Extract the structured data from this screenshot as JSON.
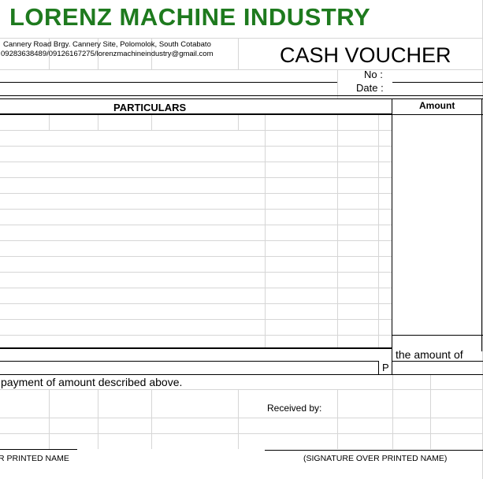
{
  "header": {
    "company_name": "LORENZ MACHINE INDUSTRY",
    "address_line1": "Cannery Road Brgy. Cannery Site, Polomolok, South Cotabato",
    "address_line2": "09283638489/09126167275/lorenzmachineindustry@gmail.com",
    "document_title": "CASH VOUCHER"
  },
  "fields": {
    "no_label": "No :",
    "date_label": "Date :"
  },
  "table": {
    "particulars_header": "PARTICULARS",
    "amount_header": "Amount"
  },
  "footer": {
    "amount_of_text": "the amount of",
    "currency_symbol": "P",
    "payment_text": "payment of amount described above.",
    "received_by_label": "Received by:",
    "signature_left": "R PRINTED NAME",
    "signature_right": "(SIGNATURE OVER PRINTED NAME)"
  },
  "colors": {
    "company_name": "#1e7a1e",
    "gridline": "#d6d6d6"
  }
}
